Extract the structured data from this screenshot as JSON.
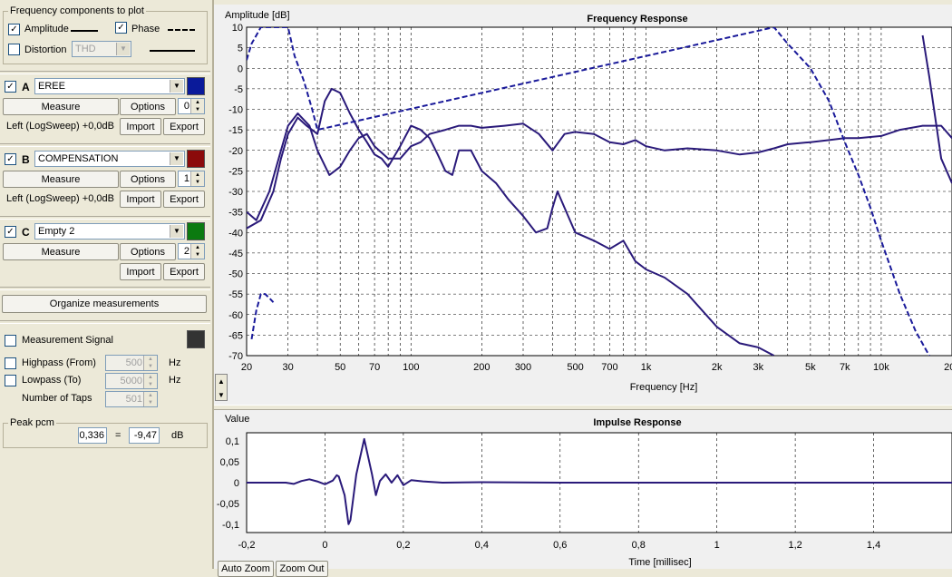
{
  "components": {
    "title": "Frequency components to plot",
    "amplitude_label": "Amplitude",
    "phase_label": "Phase",
    "distortion_label": "Distortion",
    "distortion_value": "THD"
  },
  "measurements": [
    {
      "letter": "A",
      "name": "EREE",
      "color": "#0a1a9a",
      "measure": "Measure",
      "options": "Options",
      "spin": "0",
      "info": "Left (LogSweep) +0,0dB",
      "import": "Import",
      "export": "Export"
    },
    {
      "letter": "B",
      "name": "COMPENSATION",
      "color": "#8b0a0a",
      "measure": "Measure",
      "options": "Options",
      "spin": "1",
      "info": "Left (LogSweep) +0,0dB",
      "import": "Import",
      "export": "Export"
    },
    {
      "letter": "C",
      "name": "Empty 2",
      "color": "#0b7a10",
      "measure": "Measure",
      "options": "Options",
      "spin": "2",
      "info": "",
      "import": "Import",
      "export": "Export"
    }
  ],
  "organize_label": "Organize measurements",
  "signal": {
    "measurement_signal": "Measurement Signal",
    "highpass_label": "Highpass (From)",
    "highpass_value": "500",
    "lowpass_label": "Lowpass (To)",
    "lowpass_value": "5000",
    "taps_label": "Number of Taps",
    "taps_value": "501",
    "hz": "Hz"
  },
  "peak": {
    "title": "Peak pcm",
    "value": "0,336",
    "eq": "=",
    "db_value": "-9,47",
    "db": "dB"
  },
  "freq_chart": {
    "title": "Frequency Response",
    "ylabel": "Amplitude [dB]",
    "xlabel": "Frequency [Hz]",
    "y_ticks": [
      "10",
      "5",
      "0",
      "-5",
      "-10",
      "-15",
      "-20",
      "-25",
      "-30",
      "-35",
      "-40",
      "-45",
      "-50",
      "-55",
      "-60",
      "-65",
      "-70"
    ],
    "x_ticks": [
      "20",
      "30",
      "50",
      "70",
      "100",
      "200",
      "300",
      "500",
      "700",
      "1k",
      "2k",
      "3k",
      "5k",
      "7k",
      "10k",
      "20k"
    ]
  },
  "imp_chart": {
    "title": "Impulse Response",
    "ylabel": "Value",
    "xlabel": "Time [millisec]",
    "y_ticks": [
      "0,1",
      "0,05",
      "0",
      "-0,05",
      "-0,1"
    ],
    "x_ticks": [
      "-0,2",
      "0",
      "0,2",
      "0,4",
      "0,6",
      "0,8",
      "1",
      "1,2",
      "1,4"
    ]
  },
  "zoom": {
    "auto": "Auto Zoom",
    "out": "Zoom Out"
  },
  "chart_data": [
    {
      "type": "line",
      "title": "Frequency Response",
      "xlabel": "Frequency [Hz]",
      "ylabel": "Amplitude [dB]",
      "xscale": "log",
      "xlim": [
        20,
        20000
      ],
      "ylim": [
        -70,
        10
      ],
      "grid": true,
      "series": [
        {
          "style": "solid",
          "color": "#2a1a7a",
          "x": [
            20,
            22,
            25,
            28,
            30,
            33,
            37,
            40,
            45,
            50,
            55,
            60,
            65,
            70,
            80,
            90,
            100,
            110,
            120,
            140,
            160,
            180,
            200,
            250,
            300,
            350,
            400,
            450,
            500,
            600,
            700,
            800,
            900,
            1000,
            1200,
            1500,
            2000,
            2500,
            3000,
            3500,
            4000,
            5000,
            6000,
            7000,
            8000,
            10000,
            12000,
            15000,
            18000,
            20000
          ],
          "y": [
            -35,
            -37,
            -30,
            -20,
            -14,
            -11,
            -14,
            -20,
            -26,
            -24,
            -20,
            -17,
            -16,
            -19,
            -22,
            -22,
            -19,
            -18,
            -16,
            -15,
            -14,
            -14,
            -14.5,
            -14,
            -13.5,
            -16,
            -20,
            -16,
            -15.5,
            -16,
            -18,
            -18.5,
            -17.5,
            -19,
            -20,
            -19.5,
            -20,
            -21,
            -20.5,
            -19.5,
            -18.5,
            -18,
            -17.5,
            -17,
            -17,
            -16.5,
            -15,
            -14,
            -14,
            -17
          ]
        },
        {
          "style": "solid",
          "color": "#2a1a7a",
          "x": [
            20,
            23,
            26,
            28,
            30,
            33,
            36,
            40,
            43,
            46,
            50,
            55,
            60,
            65,
            70,
            75,
            80,
            90,
            100,
            110,
            120,
            130,
            140,
            150,
            160,
            180,
            200,
            230,
            260,
            300,
            340,
            380,
            400,
            420,
            450,
            500,
            600,
            700,
            800,
            900,
            1000,
            1200,
            1500,
            2000,
            2500,
            3000,
            3500
          ],
          "y": [
            -39,
            -37,
            -30,
            -22,
            -16,
            -12,
            -14,
            -16,
            -8,
            -5,
            -6,
            -11,
            -15,
            -18,
            -21,
            -22,
            -24,
            -19,
            -14,
            -15,
            -17,
            -21,
            -25,
            -26,
            -20,
            -20,
            -25,
            -28,
            -32,
            -36,
            -40,
            -39,
            -34,
            -30,
            -34,
            -40,
            -42,
            -44,
            -42,
            -47,
            -49,
            -51,
            -55,
            -63,
            -67,
            -68,
            -70
          ]
        },
        {
          "style": "solid",
          "color": "#2a1a7a",
          "x": [
            15000,
            16000,
            18000,
            20000
          ],
          "y": [
            8,
            -2,
            -22,
            -28
          ]
        },
        {
          "style": "dashed",
          "color": "#1a1a9a",
          "x": [
            20,
            21,
            22,
            23,
            30,
            32,
            35,
            38,
            40,
            3500,
            4000,
            5000,
            6000,
            7000,
            8000,
            9000,
            10000,
            12000,
            14000,
            16000
          ],
          "y": [
            2,
            6,
            8,
            10,
            10,
            3,
            -3,
            -10,
            -15,
            10,
            6,
            0,
            -8,
            -18,
            -26,
            -34,
            -42,
            -55,
            -64,
            -70
          ]
        },
        {
          "style": "dashed",
          "color": "#1a1a9a",
          "x": [
            21,
            22,
            23,
            24,
            25,
            26
          ],
          "y": [
            -66,
            -59,
            -55,
            -55,
            -56,
            -57
          ]
        }
      ]
    },
    {
      "type": "line",
      "title": "Impulse Response",
      "xlabel": "Time [millisec]",
      "ylabel": "Value",
      "xlim": [
        -0.2,
        1.6
      ],
      "ylim": [
        -0.12,
        0.12
      ],
      "grid": true,
      "series": [
        {
          "color": "#2a1a7a",
          "x": [
            -0.2,
            -0.1,
            -0.08,
            -0.06,
            -0.04,
            -0.02,
            0,
            0.02,
            0.03,
            0.035,
            0.05,
            0.06,
            0.065,
            0.08,
            0.1,
            0.12,
            0.13,
            0.14,
            0.155,
            0.17,
            0.185,
            0.2,
            0.22,
            0.25,
            0.3,
            0.4,
            0.6,
            0.8,
            1.0,
            1.2,
            1.4,
            1.6
          ],
          "y": [
            0,
            0,
            -0.003,
            0.004,
            0.008,
            0.003,
            -0.004,
            0.005,
            0.018,
            0.015,
            -0.03,
            -0.1,
            -0.09,
            0.02,
            0.105,
            0.02,
            -0.03,
            0.004,
            0.02,
            0.0,
            0.018,
            -0.006,
            0.006,
            0.003,
            0.0,
            0.001,
            0.0,
            0.0,
            0.0,
            0.0,
            0.0,
            0.0
          ]
        }
      ]
    }
  ]
}
